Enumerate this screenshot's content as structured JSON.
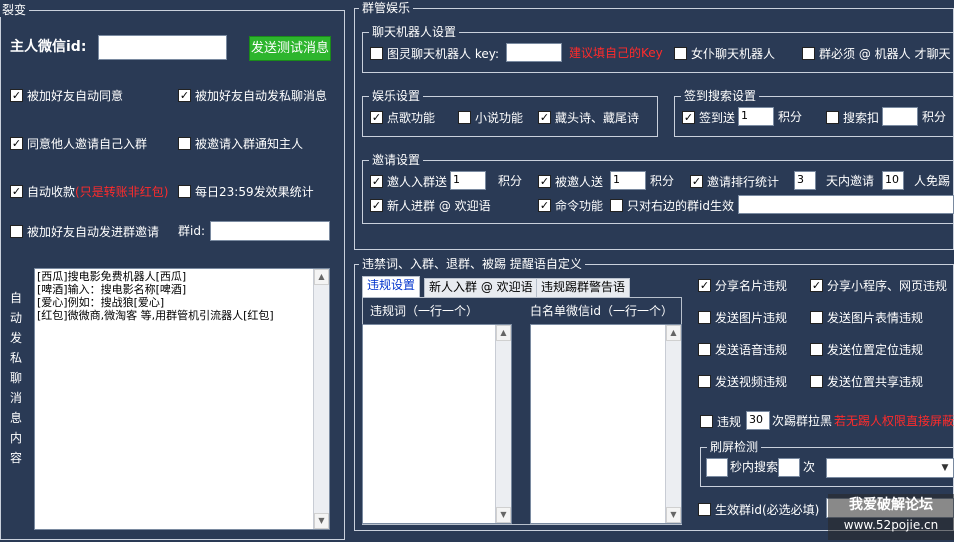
{
  "fission": {
    "title": "裂变",
    "owner_wechat_label": "主人微信id:",
    "owner_wechat_value": "",
    "send_test_button": "发送测试消息",
    "accent_button_color": "#2db52d",
    "checks": [
      {
        "label": "被加好友自动同意",
        "checked": true
      },
      {
        "label": "被加好友自动发私聊消息",
        "checked": true
      },
      {
        "label": "同意他人邀请自己入群",
        "checked": true
      },
      {
        "label": "被邀请入群通知主人",
        "checked": false
      },
      {
        "label": "自动收款",
        "checked": true
      },
      {
        "label": "每日23:59发效果统计",
        "checked": false
      },
      {
        "label": "被加好友自动发进群邀请",
        "checked": false
      }
    ],
    "auto_pay_note": "(只是转账非红包)",
    "group_id_label": "群id:",
    "group_id_value": "",
    "side_label": [
      "自",
      "动",
      "发",
      "私",
      "聊",
      "消",
      "息",
      "内",
      "容"
    ],
    "message_lines": [
      "[西瓜]搜电影免费机器人[西瓜]",
      "[啤酒]输入：搜电影名称[啤酒]",
      "[爱心]例如：搜战狼[爱心]",
      "[红包]微微商,微淘客 等,用群管机引流器人[红包]"
    ]
  },
  "group_mgmt": {
    "title": "群管娱乐",
    "chatbot": {
      "title": "聊天机器人设置",
      "tuling_label": "图灵聊天机器人 key:",
      "tuling_key": "",
      "tuling_hint": "建议填自己的Key",
      "female_label": "女仆聊天机器人",
      "mention_label": "群必须 @ 机器人 才聊天"
    },
    "entertainment": {
      "title": "娱乐设置",
      "items": [
        {
          "label": "点歌功能",
          "checked": true
        },
        {
          "label": "小说功能",
          "checked": false
        },
        {
          "label": "藏头诗、藏尾诗",
          "checked": true
        }
      ]
    },
    "signin": {
      "title": "签到搜索设置",
      "signin_label": "签到送",
      "signin_value": "1",
      "points1": "积分",
      "search_label": "搜索扣",
      "search_value": "",
      "points2": "积分"
    },
    "invite": {
      "title": "邀请设置",
      "invite_send_label": "邀人入群送",
      "invite_send_value": "1",
      "points_a": "积分",
      "invited_label": "被邀人送",
      "invited_value": "1",
      "points_b": "积分",
      "rank_label": "邀请排行统计",
      "rank_days": "3",
      "days_label": "天内邀请",
      "rank_count": "10",
      "free_label": "人免踢",
      "welcome_label": "新人进群 @ 欢迎语",
      "command_label": "命令功能",
      "right_only_label": "只对右边的群id生效",
      "right_only_value": ""
    }
  },
  "violations": {
    "title": "违禁词、入群、退群、被踢 提醒语自定义",
    "tabs": [
      "违规设置",
      "新人入群 @ 欢迎语",
      "违规踢群警告语"
    ],
    "list1_label": "违规词（一行一个）",
    "list2_label": "白名单微信id（一行一个）",
    "options": [
      {
        "label": "分享名片违规",
        "checked": true
      },
      {
        "label": "分享小程序、网页违规",
        "checked": true
      },
      {
        "label": "发送图片违规",
        "checked": false
      },
      {
        "label": "发送图片表情违规",
        "checked": false
      },
      {
        "label": "发送语音违规",
        "checked": false
      },
      {
        "label": "发送位置定位违规",
        "checked": false
      },
      {
        "label": "发送视频违规",
        "checked": false
      },
      {
        "label": "发送位置共享违规",
        "checked": false
      }
    ],
    "kick_prefix": "违规",
    "kick_value": "30",
    "kick_suffix": "次踢群拉黑",
    "kick_hint": "若无踢人权限直接屏蔽",
    "flood": {
      "title": "刷屏检测",
      "seconds_value": "",
      "seconds_label": "秒内搜索",
      "times_value": "",
      "times_label": "次",
      "select_value": ""
    },
    "effective_label": "生效群id(必选必填)",
    "effective_value": ""
  },
  "watermark": {
    "line1": "我爱破解论坛",
    "line2": "www.52pojie.cn"
  }
}
